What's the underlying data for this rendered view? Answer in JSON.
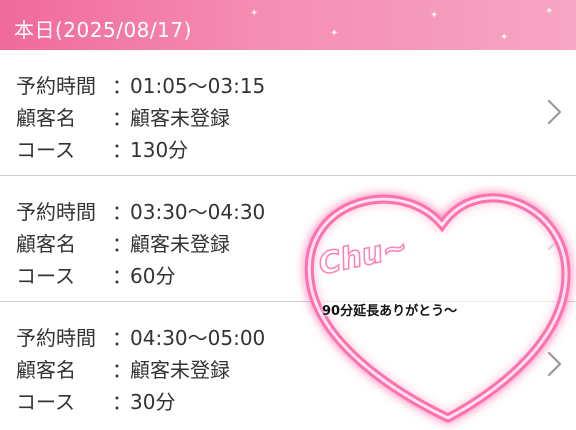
{
  "header": {
    "title": "本日(2025/08/17)"
  },
  "labels": {
    "time": "予約時間",
    "customer": "顧客名",
    "course": "コース",
    "colon": "："
  },
  "reservations": [
    {
      "time": "01:05〜03:15",
      "customer": "顧客未登録",
      "course": "130分"
    },
    {
      "time": "03:30〜04:30",
      "customer": "顧客未登録",
      "course": "60分"
    },
    {
      "time": "04:30〜05:00",
      "customer": "顧客未登録",
      "course": "30分"
    }
  ],
  "sticker": {
    "heart_text": "Chu~",
    "message": "90分延長ありがとう〜"
  },
  "colors": {
    "header": "#f06a9c",
    "heart": "#ff6fae"
  },
  "icons": {
    "chevron": "chevron-right-icon",
    "heart": "heart-sticker"
  }
}
